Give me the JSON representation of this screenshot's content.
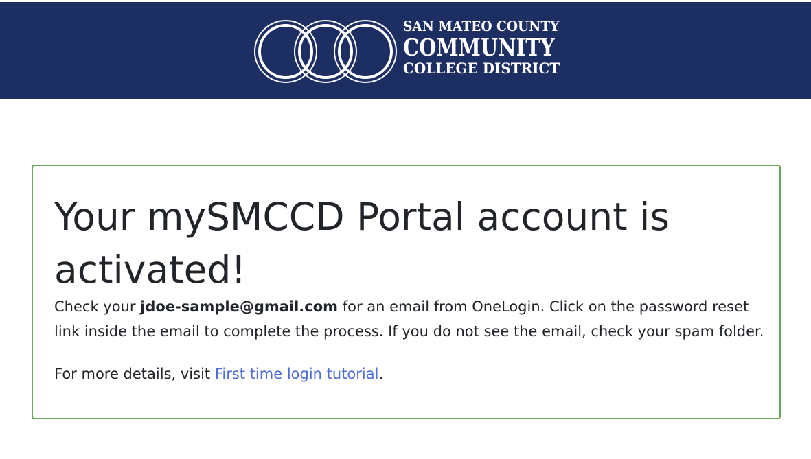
{
  "header": {
    "logo": {
      "line1": "SAN MATEO COUNTY",
      "line2": "COMMUNITY",
      "line3": "COLLEGE DISTRICT"
    },
    "background_color": "#1d2e63"
  },
  "card": {
    "border_color": "#6aa35a",
    "title": "Your mySMCCD Portal account is activated!",
    "message_prefix": "Check your ",
    "email": "jdoe-sample@gmail.com",
    "message_suffix": " for an email from OneLogin. Click on the password reset link inside the email to complete the process. If you do not see the email, check your spam folder.",
    "details_prefix": "For more details, visit ",
    "tutorial_link_text": "First time login tutorial",
    "details_suffix": ".",
    "link_color": "#4f6fd4"
  }
}
